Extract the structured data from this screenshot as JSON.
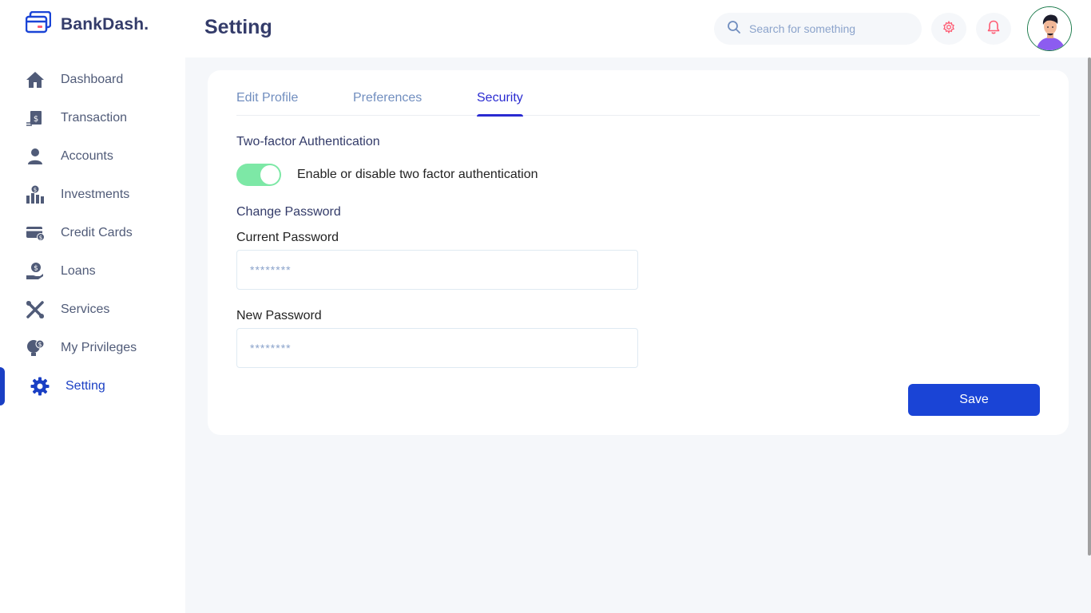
{
  "app": {
    "name": "BankDash.",
    "page_title": "Setting"
  },
  "sidebar": {
    "items": [
      {
        "label": "Dashboard",
        "icon": "home-icon"
      },
      {
        "label": "Transaction",
        "icon": "transaction-icon"
      },
      {
        "label": "Accounts",
        "icon": "user-icon"
      },
      {
        "label": "Investments",
        "icon": "investment-icon"
      },
      {
        "label": "Credit Cards",
        "icon": "credit-card-icon"
      },
      {
        "label": "Loans",
        "icon": "loan-icon"
      },
      {
        "label": "Services",
        "icon": "services-icon"
      },
      {
        "label": "My Privileges",
        "icon": "privileges-icon"
      },
      {
        "label": "Setting",
        "icon": "gear-icon",
        "active": true
      }
    ]
  },
  "header": {
    "search_placeholder": "Search for something"
  },
  "tabs": [
    {
      "label": "Edit Profile"
    },
    {
      "label": "Preferences"
    },
    {
      "label": "Security",
      "active": true
    }
  ],
  "security": {
    "two_factor_title": "Two-factor Authentication",
    "two_factor_enabled": true,
    "two_factor_label": "Enable or disable two factor authentication",
    "change_password_title": "Change Password",
    "current_password_label": "Current Password",
    "current_password_placeholder": "********",
    "new_password_label": "New Password",
    "new_password_placeholder": "********",
    "save_label": "Save"
  },
  "colors": {
    "brand": "#343c6a",
    "accent": "#1a44d6",
    "active_tab": "#2a2bd1",
    "toggle_on": "#7de8a6",
    "notification": "#fe5c73"
  }
}
